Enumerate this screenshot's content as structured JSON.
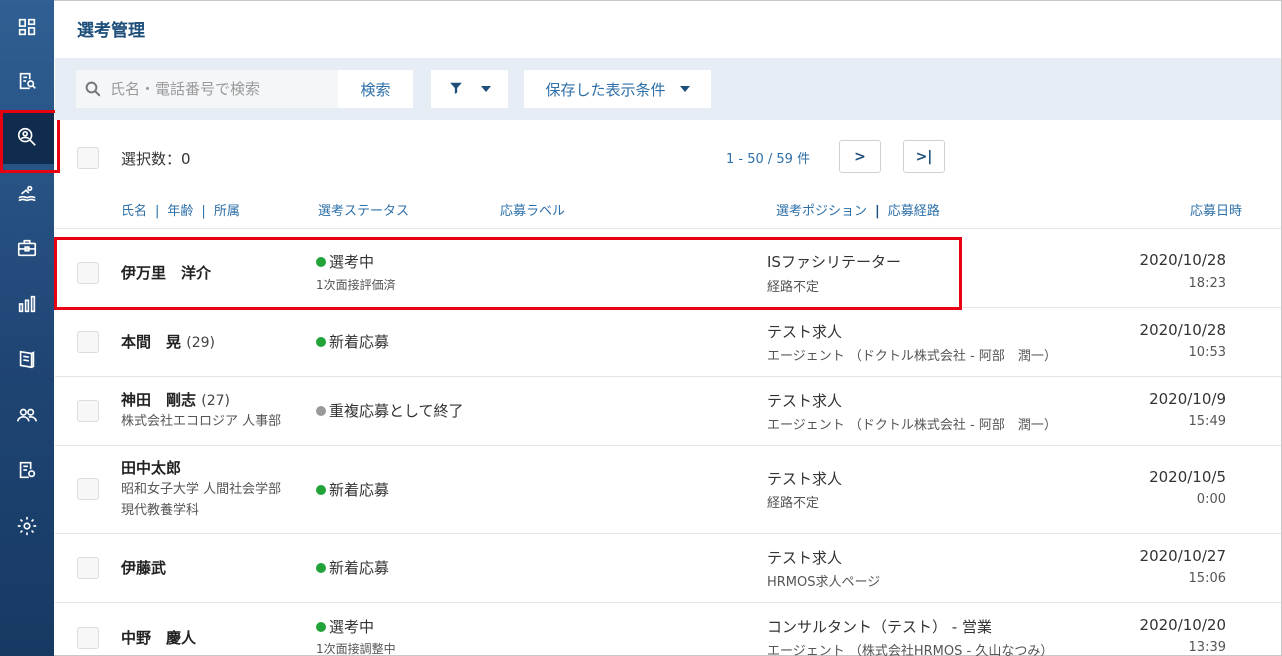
{
  "colors": {
    "sidebar": "#1f4574",
    "accent": "#2d6fa8",
    "highlight": "#e60012",
    "status_active": "#22a339",
    "status_closed": "#9a9a9a"
  },
  "sidebar": {
    "items": [
      {
        "icon": "dashboard-icon"
      },
      {
        "icon": "document-search-icon"
      },
      {
        "icon": "candidate-search-icon",
        "active": true
      },
      {
        "icon": "swimmer-icon"
      },
      {
        "icon": "briefcase-icon"
      },
      {
        "icon": "bar-chart-icon"
      },
      {
        "icon": "book-icon"
      },
      {
        "icon": "users-icon"
      },
      {
        "icon": "document-settings-icon"
      },
      {
        "icon": "gear-icon"
      }
    ]
  },
  "header": {
    "title": "選考管理"
  },
  "toolbar": {
    "search_placeholder": "氏名・電話番号で検索",
    "search_label": "検索",
    "saved_conditions_label": "保存した表示条件"
  },
  "list": {
    "selected_count": "選択数：0",
    "pagination": "1 - 50 / 59 件",
    "next_label": ">",
    "last_label": ">|",
    "columns": {
      "name": "氏名",
      "age": "年齢",
      "affiliation": "所属",
      "status": "選考ステータス",
      "label": "応募ラベル",
      "position": "選考ポジション",
      "route": "応募経路",
      "date": "応募日時"
    },
    "rows": [
      {
        "name": "伊万里　洋介",
        "age": "",
        "org": "",
        "status": "選考中",
        "status_color": "#22a339",
        "substatus": "1次面接評価済",
        "position": "ISファシリテーター",
        "route": "経路不定",
        "date": "2020/10/28",
        "time": "18:23"
      },
      {
        "name": "本間　晃",
        "age": "(29)",
        "org": "",
        "status": "新着応募",
        "status_color": "#22a339",
        "substatus": "",
        "position": "テスト求人",
        "route": "エージェント （ドクトル株式会社 - 阿部　潤一）",
        "date": "2020/10/28",
        "time": "10:53"
      },
      {
        "name": "神田　剛志",
        "age": "(27)",
        "org": "株式会社エコロジア 人事部",
        "status": "重複応募として終了",
        "status_color": "#9a9a9a",
        "substatus": "",
        "position": "テスト求人",
        "route": "エージェント （ドクトル株式会社 - 阿部　潤一）",
        "date": "2020/10/9",
        "time": "15:49"
      },
      {
        "name": "田中太郎",
        "age": "",
        "org": "昭和女子大学 人間社会学部",
        "org2": "現代教養学科",
        "status": "新着応募",
        "status_color": "#22a339",
        "substatus": "",
        "position": "テスト求人",
        "route": "経路不定",
        "date": "2020/10/5",
        "time": "0:00"
      },
      {
        "name": "伊藤武",
        "age": "",
        "org": "",
        "status": "新着応募",
        "status_color": "#22a339",
        "substatus": "",
        "position": "テスト求人",
        "route": "HRMOS求人ページ",
        "date": "2020/10/27",
        "time": "15:06"
      },
      {
        "name": "中野　慶人",
        "age": "",
        "org": "",
        "status": "選考中",
        "status_color": "#22a339",
        "substatus": "1次面接調整中",
        "position": "コンサルタント（テスト） - 営業",
        "route": "エージェント （株式会社HRMOS - 久山なつみ）",
        "date": "2020/10/20",
        "time": "13:39"
      }
    ]
  }
}
